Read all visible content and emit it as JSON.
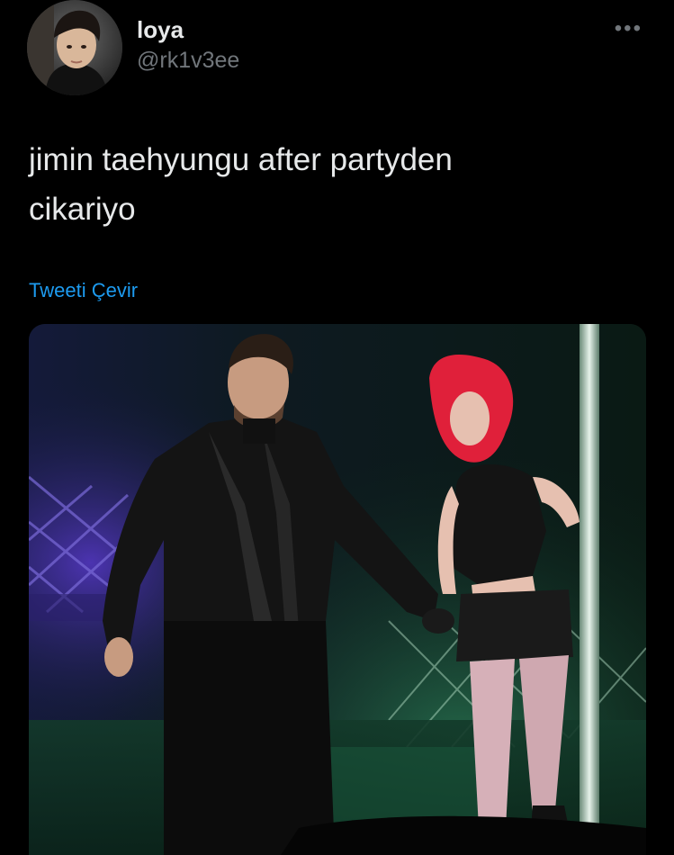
{
  "user": {
    "display_name": "loya",
    "handle": "@rk1v3ee",
    "avatar_icon": "profile-photo"
  },
  "menu": {
    "more_icon": "more-horizontal-icon",
    "more_glyph": "•••"
  },
  "tweet": {
    "text": "jimin taehyungu after partyden\ncikariyo"
  },
  "actions": {
    "translate_label": "Tweeti Çevir"
  },
  "media": {
    "type": "photo"
  },
  "colors": {
    "background": "#000000",
    "text_primary": "#e7e9ea",
    "text_secondary": "#71767b",
    "link": "#1d9bf0"
  }
}
